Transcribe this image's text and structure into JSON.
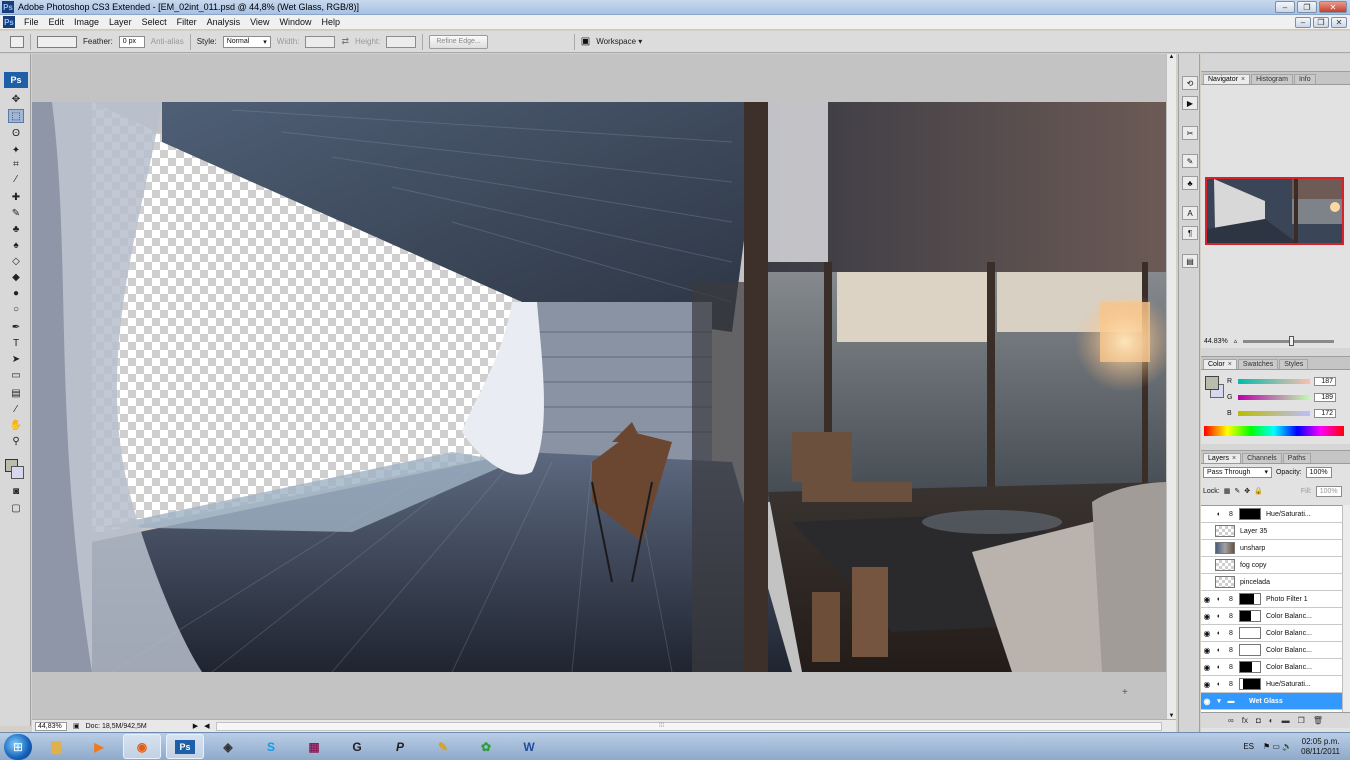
{
  "window": {
    "title": "Adobe Photoshop CS3 Extended - [EM_02int_011.psd @ 44,8% (Wet Glass, RGB/8)]",
    "app_icon": "Ps"
  },
  "menu": [
    "File",
    "Edit",
    "Image",
    "Layer",
    "Select",
    "Filter",
    "Analysis",
    "View",
    "Window",
    "Help"
  ],
  "options": {
    "feather_label": "Feather:",
    "feather_value": "0 px",
    "antialias_label": "Anti-alias",
    "style_label": "Style:",
    "style_value": "Normal",
    "width_label": "Width:",
    "height_label": "Height:",
    "refine_label": "Refine Edge...",
    "workspace_label": "Workspace ▾"
  },
  "status": {
    "zoom": "44,83%",
    "doc": "Doc: 18,5M/942,5M"
  },
  "navigator": {
    "tabs": [
      "Navigator",
      "Histogram",
      "Info"
    ],
    "zoom": "44.83%"
  },
  "color": {
    "tabs": [
      "Color",
      "Swatches",
      "Styles"
    ],
    "r_label": "R",
    "r_value": "187",
    "g_label": "G",
    "g_value": "189",
    "b_label": "B",
    "b_value": "172",
    "fg_color": "#bbbdac",
    "bg_color": "#d7d8ef"
  },
  "layers": {
    "tabs": [
      "Layers",
      "Channels",
      "Paths"
    ],
    "blend_mode": "Pass Through",
    "opacity_label": "Opacity:",
    "opacity_value": "100%",
    "lock_label": "Lock:",
    "fill_label": "Fill:",
    "fill_value": "100%",
    "items": [
      {
        "name": "Hue/Saturati...",
        "visible": false,
        "thumb": "black",
        "adjust": true
      },
      {
        "name": "Layer 35",
        "visible": false,
        "thumb": "check",
        "adjust": false
      },
      {
        "name": "unsharp",
        "visible": false,
        "thumb": "photo",
        "adjust": false
      },
      {
        "name": "fog copy",
        "visible": false,
        "thumb": "check",
        "adjust": false
      },
      {
        "name": "pincelada",
        "visible": false,
        "thumb": "check",
        "adjust": false
      },
      {
        "name": "Photo Filter 1",
        "visible": true,
        "thumb": "black",
        "adjust": true
      },
      {
        "name": "Color Balanc...",
        "visible": true,
        "thumb": "black",
        "adjust": true
      },
      {
        "name": "Color Balanc...",
        "visible": true,
        "thumb": "white",
        "adjust": true
      },
      {
        "name": "Color Balanc...",
        "visible": true,
        "thumb": "white",
        "adjust": true
      },
      {
        "name": "Color Balanc...",
        "visible": true,
        "thumb": "black",
        "adjust": true
      },
      {
        "name": "Hue/Saturati...",
        "visible": true,
        "thumb": "black",
        "adjust": true
      },
      {
        "name": "Wet Glass",
        "visible": true,
        "thumb": "folder",
        "adjust": false,
        "selected": true
      }
    ]
  },
  "taskbar": {
    "language": "ES",
    "time": "02:05 p.m.",
    "date": "08/11/2011"
  },
  "colors": {
    "accent": "#3399ff",
    "nav_frame": "#d7222c",
    "titlebar": "#b9cde6"
  }
}
